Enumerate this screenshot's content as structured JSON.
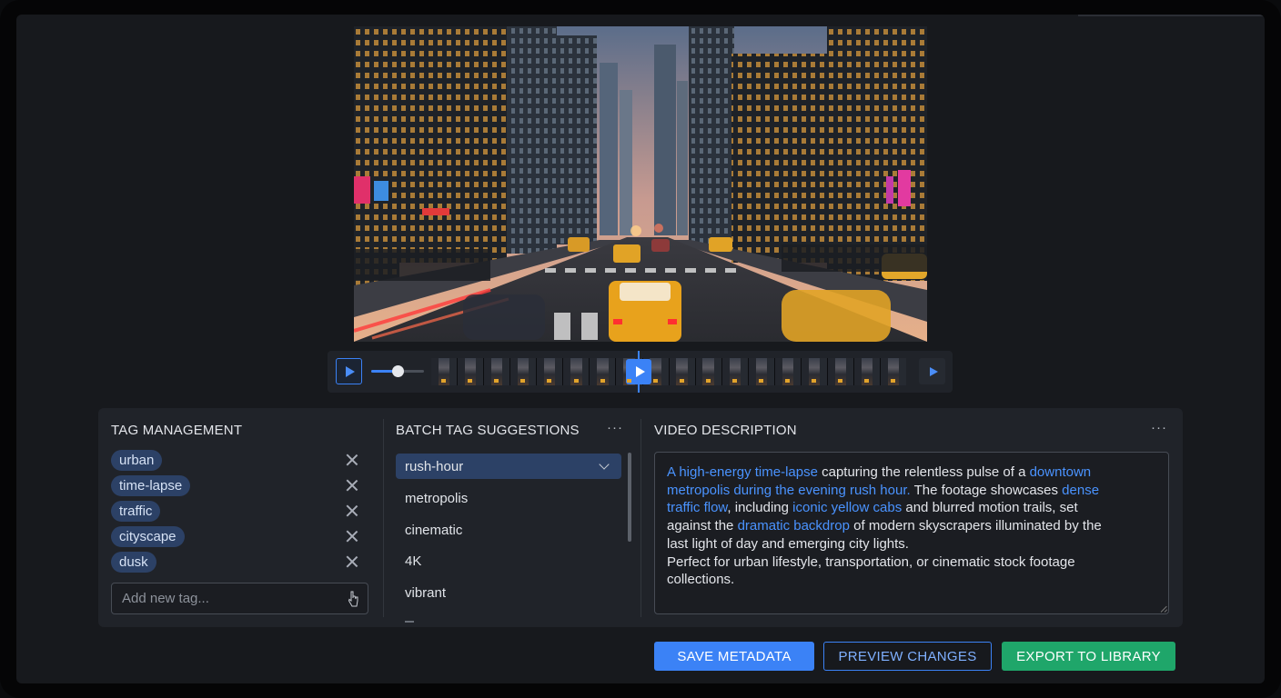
{
  "video": {
    "description": "city street at dusk",
    "timeline": {
      "volume_level": 0.45,
      "frame_count": 18,
      "playhead_position": 0.44
    }
  },
  "tags_panel": {
    "title": "TAG MANAGEMENT",
    "tags": [
      "urban",
      "time-lapse",
      "traffic",
      "cityscape",
      "dusk"
    ],
    "input_placeholder": "Add new tag...",
    "input_value": ""
  },
  "suggestions_panel": {
    "title": "BATCH TAG SUGGESTIONS",
    "more_label": "···",
    "selected": "rush-hour",
    "items": [
      "metropolis",
      "cinematic",
      "4K",
      "vibrant"
    ]
  },
  "description_panel": {
    "title": "VIDEO DESCRIPTION",
    "more_label": "···",
    "segments": [
      {
        "text": "A high-energy time-lapse",
        "highlight": true
      },
      {
        "text": " capturing the relentless pulse of a ",
        "highlight": false
      },
      {
        "text": "downtown",
        "highlight": true
      },
      {
        "text": "\n",
        "highlight": false
      },
      {
        "text": "metropolis during the evening rush hour.",
        "highlight": true
      },
      {
        "text": " The footage showcases ",
        "highlight": false
      },
      {
        "text": "dense",
        "highlight": true
      },
      {
        "text": "\n",
        "highlight": false
      },
      {
        "text": "traffic flow",
        "highlight": true
      },
      {
        "text": ", including ",
        "highlight": false
      },
      {
        "text": "iconic yellow cabs",
        "highlight": true
      },
      {
        "text": " and blurred motion trails, set",
        "highlight": false
      },
      {
        "text": "\n",
        "highlight": false
      },
      {
        "text": "against the ",
        "highlight": false
      },
      {
        "text": "dramatic backdrop",
        "highlight": true
      },
      {
        "text": " of modern skyscrapers illuminated by the",
        "highlight": false
      },
      {
        "text": "\n",
        "highlight": false
      },
      {
        "text": "last light of day and emerging city lights.",
        "highlight": false
      },
      {
        "text": "\n",
        "highlight": false
      },
      {
        "text": "Perfect for urban lifestyle, transportation, or cinematic stock footage",
        "highlight": false
      },
      {
        "text": "\n",
        "highlight": false
      },
      {
        "text": "collections.",
        "highlight": false
      }
    ]
  },
  "actions": {
    "save_label": "SAVE METADATA",
    "preview_label": "PREVIEW CHANGES",
    "export_label": "EXPORT TO LIBRARY"
  },
  "colors": {
    "accent_blue": "#3b82f6",
    "highlight_text": "#4a93ff",
    "tag_chip": "#2c4166",
    "export_green": "#1fa66a",
    "panel_bg": "#202329",
    "screen_bg": "#17191d"
  },
  "icons": {
    "play": "play-icon",
    "next": "next-icon",
    "remove_tag": "close-icon",
    "dropdown": "chevron-down-icon",
    "more": "more-horizontal-icon",
    "cursor": "hand-cursor-icon"
  }
}
